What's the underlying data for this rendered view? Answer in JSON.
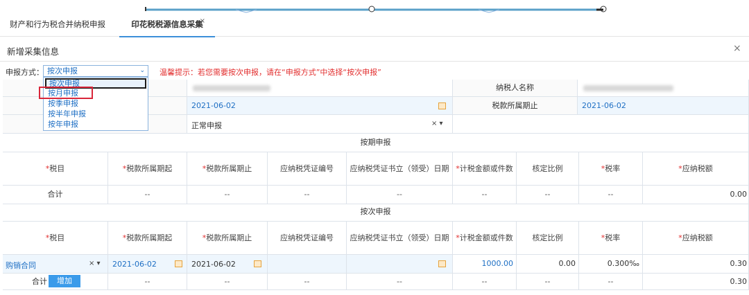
{
  "tabs": [
    {
      "label": "财产和行为税合并纳税申报",
      "active": false
    },
    {
      "label": "印花税税源信息采集",
      "active": true,
      "close": "×"
    }
  ],
  "dialog": {
    "title": "新增采集信息",
    "close": "×"
  },
  "declare_mode": {
    "label": "申报方式：",
    "value": "按次申报",
    "chevron": "⌄",
    "options": [
      "按次申报",
      "按月申报",
      "按季申报",
      "按半年申报",
      "按年申报"
    ],
    "highlighted_option": "按月申报"
  },
  "hint": "温馨提示：若您需要按次申报，请在“申报方式”中选择“按次申报”",
  "info_rows": {
    "taxpayer_name_label": "纳税人名称",
    "period_start_value": "2021-06-02",
    "period_end_label": "税款所属期止",
    "period_end_value": "2021-06-02",
    "declare_type_value": "正常申报",
    "clear_chevron": "× ▾"
  },
  "periodic_section": {
    "title": "按期申报",
    "columns": [
      {
        "label": "税目",
        "required": true
      },
      {
        "label": "税款所属期起",
        "required": true
      },
      {
        "label": "税款所属期止",
        "required": true
      },
      {
        "label": "应纳税凭证编号",
        "required": false
      },
      {
        "label": "应纳税凭证书立（领受）日期",
        "required": false
      },
      {
        "label": "计税金额或件数",
        "required": true
      },
      {
        "label": "核定比例",
        "required": false
      },
      {
        "label": "税率",
        "required": true
      },
      {
        "label": "应纳税额",
        "required": true
      }
    ],
    "total_row": {
      "label": "合计",
      "dash": "--",
      "amount": "0.00"
    }
  },
  "per_time_section": {
    "title": "按次申报",
    "columns": [
      {
        "label": "税目",
        "required": true
      },
      {
        "label": "税款所属期起",
        "required": true
      },
      {
        "label": "税款所属期止",
        "required": true
      },
      {
        "label": "应纳税凭证编号",
        "required": false
      },
      {
        "label": "应纳税凭证书立（领受）日期",
        "required": false
      },
      {
        "label": "计税金额或件数",
        "required": true
      },
      {
        "label": "核定比例",
        "required": false
      },
      {
        "label": "税率",
        "required": true
      },
      {
        "label": "应纳税额",
        "required": true
      }
    ],
    "row": {
      "tax_item": "购销合同",
      "clear_chevron": "× ▾",
      "start": "2021-06-02",
      "end": "2021-06-02",
      "amount": "1000.00",
      "ratio": "0.00",
      "rate": "0.300‰",
      "tax": "0.30"
    },
    "total_row": {
      "label": "合计",
      "add_button": "增加",
      "dash": "--",
      "amount": "0.30"
    }
  },
  "required_mark": "*",
  "colors": {
    "accent": "#3b8fd9",
    "link": "#1e6fc4",
    "warning": "#e22d2d",
    "highlight_box": "#d9263a"
  }
}
